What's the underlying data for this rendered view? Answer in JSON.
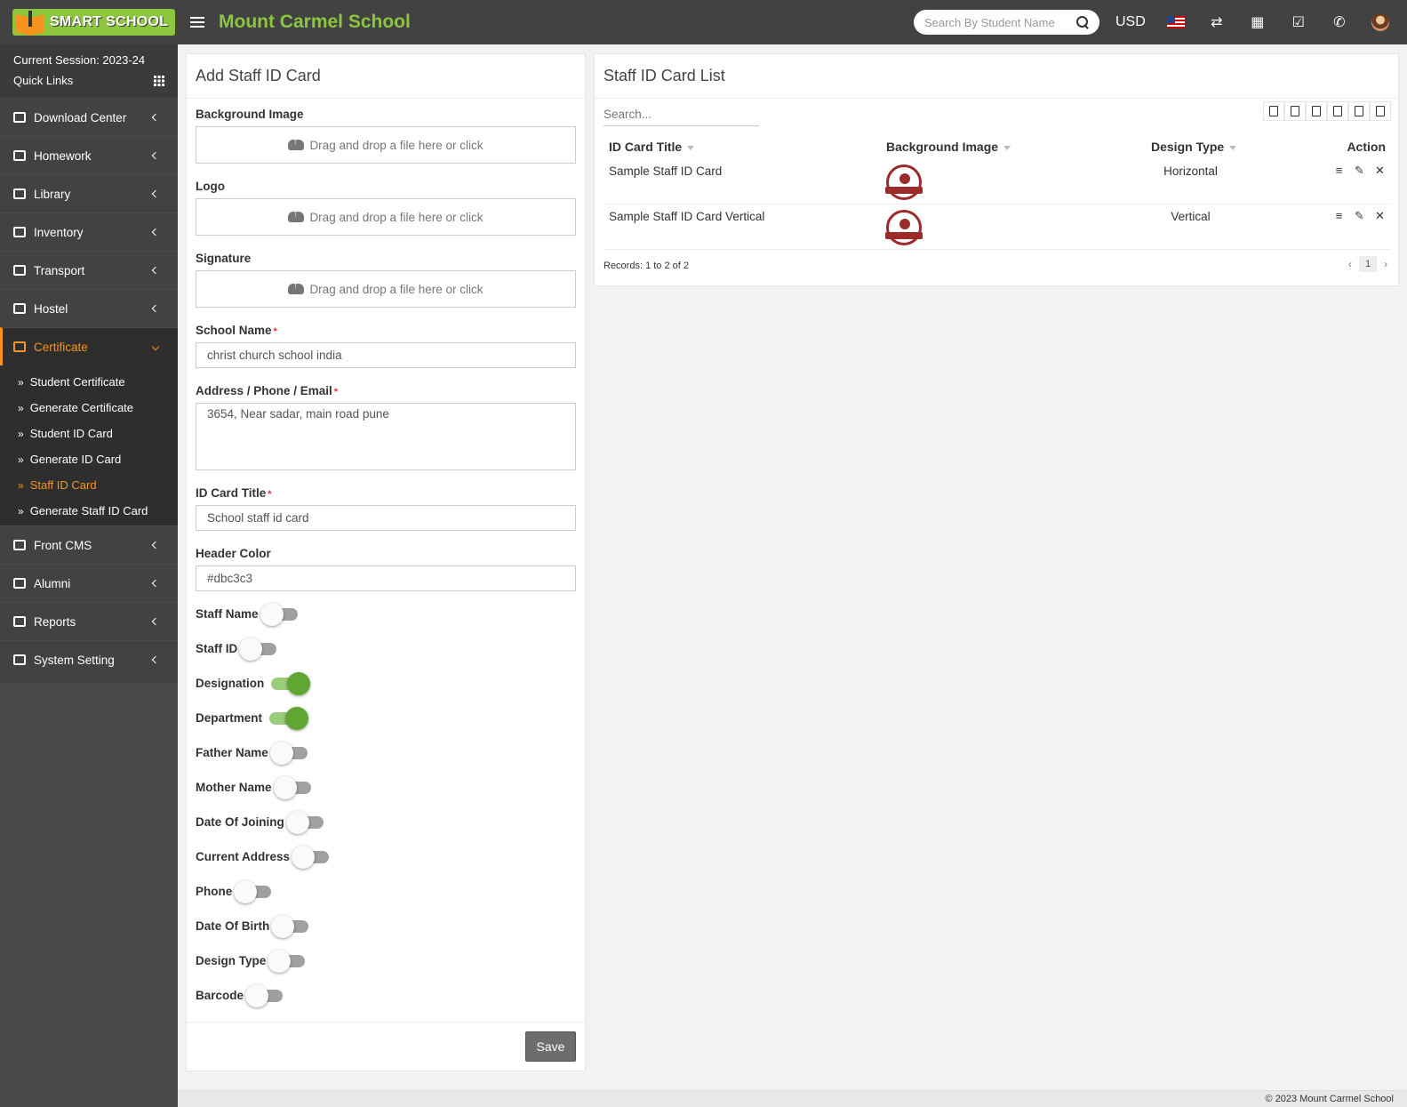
{
  "brand": {
    "logo_text": "SMART SCHOOL",
    "school_name": "Mount Carmel School"
  },
  "topbar": {
    "search_placeholder": "Search By Student Name",
    "currency": "USD"
  },
  "sidebar": {
    "session": "Current Session: 2023-24",
    "quick_links": "Quick Links",
    "menu_top": [
      {
        "label": "Download Center"
      },
      {
        "label": "Homework"
      },
      {
        "label": "Library"
      },
      {
        "label": "Inventory"
      },
      {
        "label": "Transport"
      },
      {
        "label": "Hostel"
      }
    ],
    "active_menu": "Certificate",
    "submenu": [
      {
        "label": "Student Certificate"
      },
      {
        "label": "Generate Certificate"
      },
      {
        "label": "Student ID Card"
      },
      {
        "label": "Generate ID Card"
      },
      {
        "label": "Staff ID Card"
      },
      {
        "label": "Generate Staff ID Card"
      }
    ],
    "menu_bottom": [
      {
        "label": "Front CMS"
      },
      {
        "label": "Alumni"
      },
      {
        "label": "Reports"
      },
      {
        "label": "System Setting"
      }
    ]
  },
  "add_form": {
    "title": "Add Staff ID Card",
    "background_image_label": "Background Image",
    "logo_label": "Logo",
    "signature_label": "Signature",
    "dropzone_text": "Drag and drop a file here or click",
    "school_name_label": "School Name",
    "school_name_value": "christ church school india",
    "address_label": "Address / Phone / Email",
    "address_value": "3654, Near sadar, main road pune",
    "id_card_title_label": "ID Card Title",
    "id_card_title_value": "School staff id card",
    "header_color_label": "Header Color",
    "header_color_value": "#dbc3c3",
    "toggles": [
      {
        "label": "Staff Name",
        "on": false
      },
      {
        "label": "Staff ID",
        "on": false
      },
      {
        "label": "Designation",
        "on": true
      },
      {
        "label": "Department",
        "on": true
      },
      {
        "label": "Father Name",
        "on": false
      },
      {
        "label": "Mother Name",
        "on": false
      },
      {
        "label": "Date Of Joining",
        "on": false
      },
      {
        "label": "Current Address",
        "on": false
      },
      {
        "label": "Phone",
        "on": false
      },
      {
        "label": "Date Of Birth",
        "on": false
      },
      {
        "label": "Design Type",
        "on": false
      },
      {
        "label": "Barcode",
        "on": false
      }
    ],
    "save_label": "Save"
  },
  "list": {
    "title": "Staff ID Card List",
    "search_placeholder": "Search...",
    "columns": [
      "ID Card Title",
      "Background Image",
      "Design Type",
      "Action"
    ],
    "rows": [
      {
        "title": "Sample Staff ID Card",
        "design_type": "Horizontal"
      },
      {
        "title": "Sample Staff ID Card Vertical",
        "design_type": "Vertical"
      }
    ],
    "records": "Records: 1 to 2 of 2",
    "page": "1"
  },
  "footer": {
    "copyright": "© 2023 Mount Carmel School"
  },
  "colors": {
    "accent": "#f7941d",
    "brand_green": "#8cc63f",
    "toggle_on": "#5fa732"
  }
}
